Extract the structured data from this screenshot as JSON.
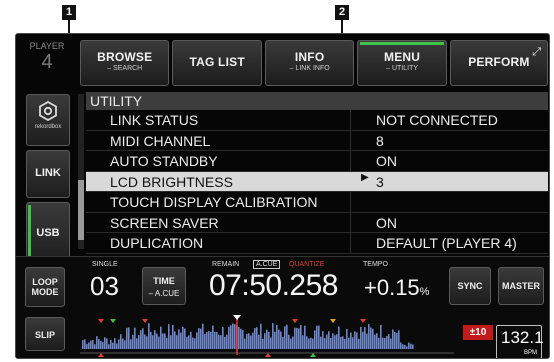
{
  "callouts": {
    "one": "1",
    "two": "2"
  },
  "player": {
    "label": "PLAYER",
    "number": "4"
  },
  "topbar": {
    "browse": {
      "label": "BROWSE",
      "sub": "– SEARCH"
    },
    "tag_list": {
      "label": "TAG LIST"
    },
    "info": {
      "label": "INFO",
      "sub": "– LINK INFO"
    },
    "menu": {
      "label": "MENU",
      "sub": "– UTILITY"
    },
    "perform": {
      "label": "PERFORM"
    }
  },
  "sidebar": {
    "rekordbox": "rekordbox",
    "link": "LINK",
    "usb": "USB"
  },
  "utility": {
    "header": "UTILITY",
    "rows": [
      {
        "key": "LINK STATUS",
        "value": "NOT CONNECTED"
      },
      {
        "key": "MIDI CHANNEL",
        "value": "8"
      },
      {
        "key": "AUTO STANDBY",
        "value": "ON"
      },
      {
        "key": "LCD BRIGHTNESS",
        "value": "3",
        "selected": true
      },
      {
        "key": "TOUCH DISPLAY CALIBRATION",
        "value": ""
      },
      {
        "key": "SCREEN SAVER",
        "value": "ON"
      },
      {
        "key": "DUPLICATION",
        "value": "DEFAULT (PLAYER 4)"
      }
    ]
  },
  "deck": {
    "loop_mode": [
      "LOOP",
      "MODE"
    ],
    "slip": "SLIP",
    "single_label": "SINGLE",
    "track_number": "03",
    "time_button": [
      "TIME",
      "– A.CUE"
    ],
    "remain_label": "REMAIN",
    "acue_label": "A.CUE",
    "quantize_label": "QUANTIZE",
    "time_value": "07:50.258",
    "tempo_label": "TEMPO",
    "tempo_value": "+0.15",
    "tempo_unit": "%",
    "sync": "SYNC",
    "master": "MASTER",
    "tempo_range": "±10",
    "bpm_value": "132.1",
    "bpm_unit": "BPM",
    "playhead_fraction": 0.42
  },
  "colors": {
    "accent_green": "#3fc248",
    "highlight_row": "#d9d9d9",
    "quantize_red": "#e0402a",
    "waveform_blue": "#6f86c8"
  }
}
